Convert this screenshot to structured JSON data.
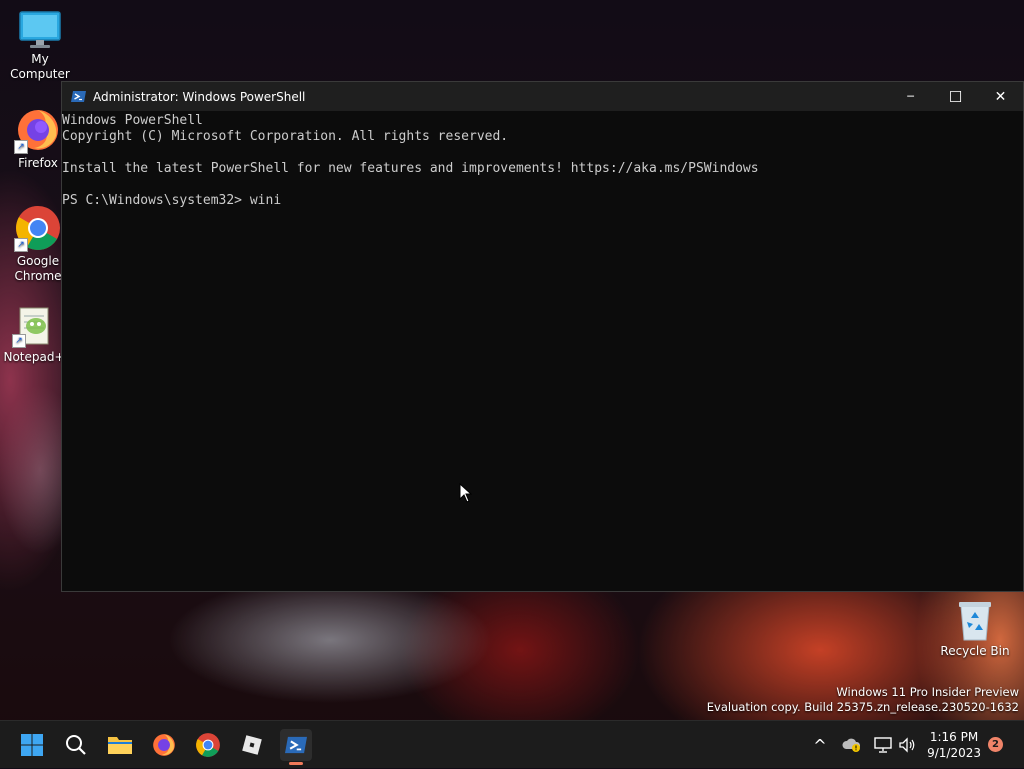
{
  "desktop": {
    "icons": [
      {
        "label": "My Computer",
        "icon": "monitor-icon"
      },
      {
        "label": "Firefox",
        "icon": "firefox-icon"
      },
      {
        "label": "Google Chrome",
        "icon": "chrome-icon"
      },
      {
        "label": "Notepad+",
        "icon": "notepad-plus-plus-icon"
      },
      {
        "label": "Recycle Bin",
        "icon": "recycle-bin-icon"
      }
    ]
  },
  "window": {
    "title": "Administrator: Windows PowerShell",
    "buttons": {
      "minimize": "─",
      "maximize": "☐",
      "close": "✕"
    },
    "console_lines": [
      "Windows PowerShell",
      "Copyright (C) Microsoft Corporation. All rights reserved.",
      "",
      "Install the latest PowerShell for new features and improvements! https://aka.ms/PSWindows",
      "",
      "PS C:\\Windows\\system32> wini"
    ]
  },
  "watermark": {
    "line1": "Windows 11 Pro Insider Preview",
    "line2": "Evaluation copy. Build 25375.zn_release.230520-1632"
  },
  "taskbar": {
    "apps": [
      "start-icon",
      "search-icon",
      "file-explorer-icon",
      "firefox-icon",
      "chrome-icon",
      "roblox-icon",
      "powershell-icon"
    ],
    "active_app": "powershell-icon",
    "tray": {
      "chevron": "^"
    },
    "clock": {
      "time": "1:16 PM",
      "date": "9/1/2023"
    },
    "notifications": "2"
  },
  "colors": {
    "console_bg": "#0c0c0c",
    "console_text": "#cccccc",
    "titlebar": "#1f1f1f",
    "taskbar": "#1c1c1c",
    "accent": "#f07a5a"
  }
}
